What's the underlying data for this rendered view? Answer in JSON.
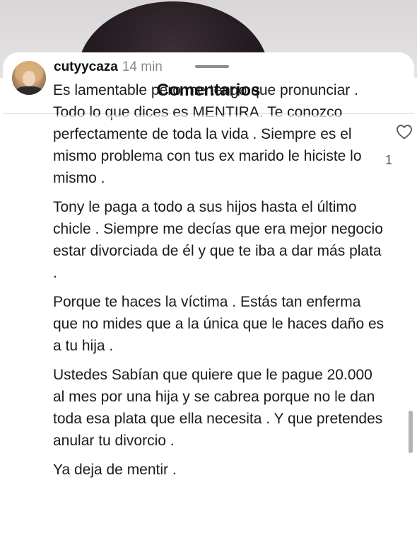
{
  "header": {
    "title": "Comentarios"
  },
  "comment": {
    "username": "cutyycaza",
    "time": "14 min",
    "paragraphs": [
      "Es lamentable pero me tengo que pronunciar . Todo lo que dices es MENTIRA. Te conozco perfectamente de toda la vida . Siempre es el mismo problema con tus ex marido le hiciste lo mismo .",
      "Tony le paga a todo a  sus  hijos hasta el último chicle . Siempre me decías que era mejor negocio estar divorciada de él y que te iba a dar más plata .",
      "Porque te haces la víctima . Estás tan enferma que no mides que a la única que le haces daño es a tu hija .",
      "Ustedes Sabían que quiere que le pague 20.000 al mes por una hija y se cabrea porque no le dan toda esa plata que ella necesita .  Y que pretendes anular tu divorcio .",
      "Ya deja de mentir ."
    ],
    "like_count": "1",
    "like_icon": "heart-outline-icon"
  },
  "colors": {
    "sheet": "#ffffff",
    "text": "#1b1b1b",
    "muted": "#8a8a8a",
    "background_top": "#d9d6d7"
  }
}
